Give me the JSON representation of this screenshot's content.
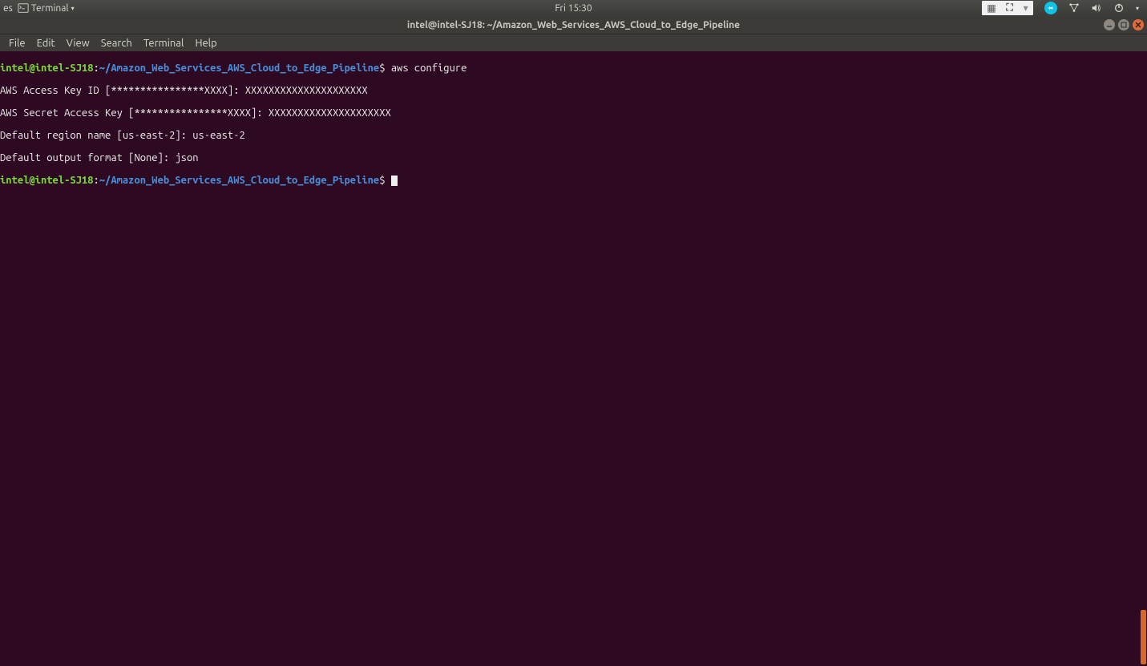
{
  "top_panel": {
    "left_truncated": "es",
    "terminal_label": "Terminal",
    "clock": "Fri 15:30"
  },
  "title_bar": {
    "title": "intel@intel-SJ18: ~/Amazon_Web_Services_AWS_Cloud_to_Edge_Pipeline"
  },
  "menu": {
    "file": "File",
    "edit": "Edit",
    "view": "View",
    "search": "Search",
    "terminal": "Terminal",
    "help": "Help"
  },
  "prompt": {
    "user_host": "intel@intel-SJ18",
    "separator": ":",
    "path_prefix": "~",
    "path": "/Amazon_Web_Services_AWS_Cloud_to_Edge_Pipeline",
    "dollar": "$"
  },
  "session": {
    "command1": " aws configure",
    "line1": "AWS Access Key ID [****************XXXX]: XXXXXXXXXXXXXXXXXXXXX",
    "line2": "AWS Secret Access Key [****************XXXX]: XXXXXXXXXXXXXXXXXXXXX",
    "line3": "Default region name [us-east-2]: us-east-2",
    "line4": "Default output format [None]: json",
    "command2": " "
  }
}
